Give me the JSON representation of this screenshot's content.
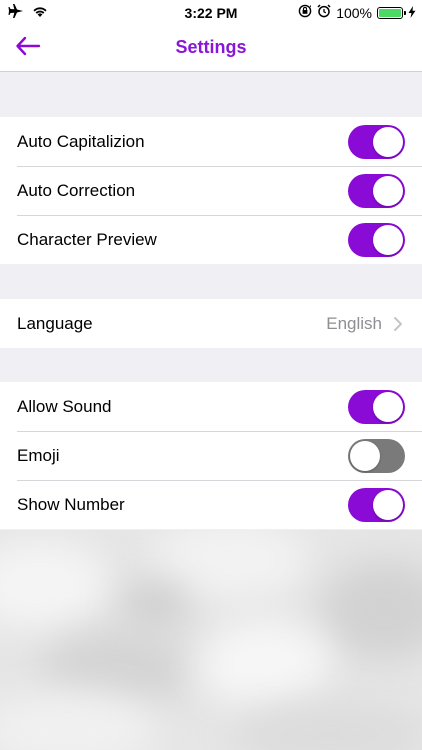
{
  "status_bar": {
    "time": "3:22 PM",
    "battery_percent": "100%",
    "battery_level": 1.0,
    "icons": [
      "airplane-icon",
      "wifi-icon",
      "orientation-lock-icon",
      "alarm-icon",
      "battery-icon",
      "charging-bolt-icon"
    ]
  },
  "nav": {
    "title": "Settings",
    "back_icon": "back-arrow-icon"
  },
  "colors": {
    "accent": "#8a0ad6",
    "title": "#8a16d8",
    "toggle_off": "#7a7a7a",
    "background": "#efeff4"
  },
  "sections": [
    {
      "items": [
        {
          "label": "Auto Capitalizion",
          "type": "toggle",
          "on": true
        },
        {
          "label": "Auto Correction",
          "type": "toggle",
          "on": true
        },
        {
          "label": "Character Preview",
          "type": "toggle",
          "on": true
        }
      ]
    },
    {
      "items": [
        {
          "label": "Language",
          "type": "disclosure",
          "value": "English"
        }
      ]
    },
    {
      "items": [
        {
          "label": "Allow Sound",
          "type": "toggle",
          "on": true
        },
        {
          "label": "Emoji",
          "type": "toggle",
          "on": false
        },
        {
          "label": "Show Number",
          "type": "toggle",
          "on": true
        }
      ]
    }
  ]
}
